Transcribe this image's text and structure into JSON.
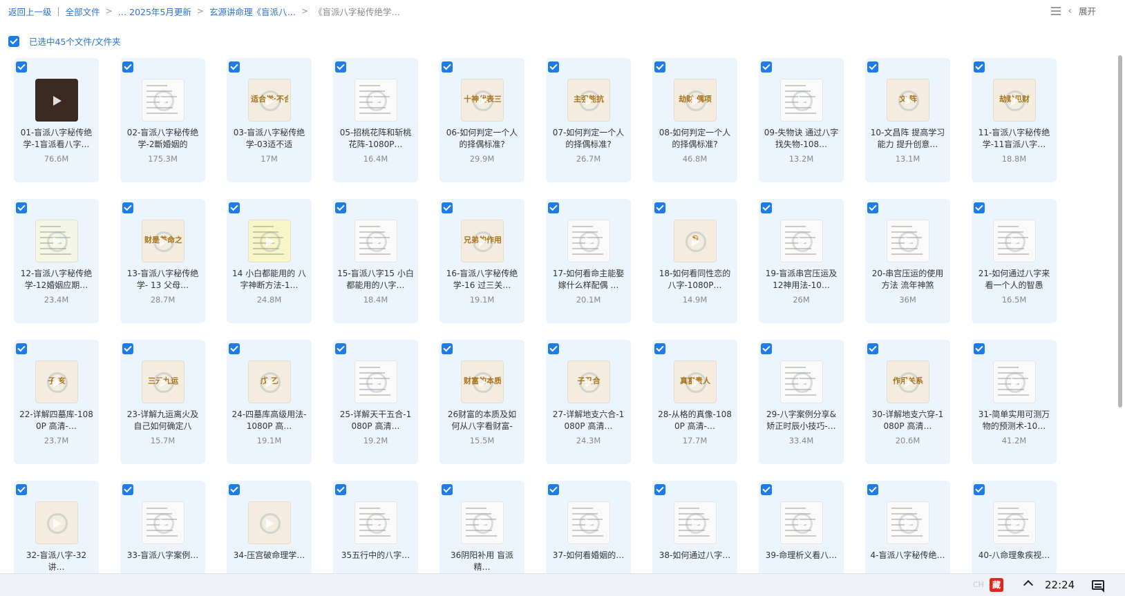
{
  "breadcrumb": {
    "items": [
      "返回上一级",
      "全部文件",
      "… 2025年5月更新",
      "玄源讲命理《盲派八…",
      "《盲派八字秘传绝学…"
    ],
    "separators": [
      "|",
      ">",
      ">",
      ">"
    ]
  },
  "toolbar": {
    "expand_label": "展开"
  },
  "selection": {
    "label": "已选中45个文件/文件夹"
  },
  "files": [
    {
      "name": "01-盲派八字秘传绝学-1盲派看八字…",
      "size": "76.6M",
      "thumb": "dark",
      "text": ""
    },
    {
      "name": "02-盲派八字秘传绝学-2斷婚姻的",
      "size": "175.3M",
      "thumb": "table",
      "text": ""
    },
    {
      "name": "03-盲派八字秘传绝学-03适不适",
      "size": "17M",
      "thumb": "paper",
      "text": "适合学·不合"
    },
    {
      "name": "05-招桃花阵和斩桃花阵-1080P…",
      "size": "16.4M",
      "thumb": "white",
      "text": ""
    },
    {
      "name": "06-如何判定一个人的择偶标准?",
      "size": "29.9M",
      "thumb": "paper",
      "text": "十神代表三观"
    },
    {
      "name": "07-如何判定一个人的择偶标准?",
      "size": "26.7M",
      "thumb": "paper",
      "text": "主强能抗"
    },
    {
      "name": "08-如何判定一个人的择偶标准?",
      "size": "46.8M",
      "thumb": "paper",
      "text": "劫财·偶项"
    },
    {
      "name": "09-失物诀 通过八字找失物-108…",
      "size": "13.2M",
      "thumb": "table",
      "text": ""
    },
    {
      "name": "10-文昌阵 提高学习能力 提升创意…",
      "size": "13.1M",
      "thumb": "paper",
      "text": "文 阵"
    },
    {
      "name": "11-盲派八字秘传绝学-11盲派八字…",
      "size": "18.8M",
      "thumb": "paper",
      "text": "劫财见财"
    },
    {
      "name": "12-盲派八字秘传绝学-12婚姻应期…",
      "size": "23.4M",
      "thumb": "green",
      "text": ""
    },
    {
      "name": "13-盲派八字秘传绝学- 13 父母…",
      "size": "28.7M",
      "thumb": "paper",
      "text": "财是养命之源"
    },
    {
      "name": "14 小白都能用的 八字神断方法-1…",
      "size": "24.8M",
      "thumb": "yellow",
      "text": ""
    },
    {
      "name": "15-盲派八字15 小白都能用的八字…",
      "size": "18.4M",
      "thumb": "table",
      "text": ""
    },
    {
      "name": "16-盲派八字秘传绝学-16 过三关…",
      "size": "19.1M",
      "thumb": "paper",
      "text": "兄弟的作用"
    },
    {
      "name": "17-如何看命主能娶嫁什么样配偶 …",
      "size": "20.1M",
      "thumb": "white",
      "text": ""
    },
    {
      "name": "18-如何看同性恋的八字-1080P…",
      "size": "14.9M",
      "thumb": "paper",
      "text": "☯"
    },
    {
      "name": "19-盲派串宫压运及12神用法-10…",
      "size": "26M",
      "thumb": "table",
      "text": ""
    },
    {
      "name": "20-串宫压运的使用方法 流年神煞",
      "size": "36M",
      "thumb": "table",
      "text": ""
    },
    {
      "name": "21-如何通过八字来看一个人的智愚",
      "size": "16.5M",
      "thumb": "table",
      "text": ""
    },
    {
      "name": "22-详解四墓库-1080P 高清-…",
      "size": "23.7M",
      "thumb": "paper",
      "text": "子 亥"
    },
    {
      "name": "23-详解九运离火及自己如何确定八",
      "size": "15.7M",
      "thumb": "paper",
      "text": "三元九运"
    },
    {
      "name": "24-四墓库高级用法-1080P 高…",
      "size": "19.1M",
      "thumb": "paper",
      "text": "戊 乙"
    },
    {
      "name": "25-详解天干五合-1080P 高清…",
      "size": "19.2M",
      "thumb": "white",
      "text": ""
    },
    {
      "name": "26财富的本质及如何从八字看财富-",
      "size": "15.5M",
      "thumb": "paper",
      "text": "财富的本质"
    },
    {
      "name": "27-详解地支六合-1080P 高清…",
      "size": "24.3M",
      "thumb": "paper",
      "text": "子丑合"
    },
    {
      "name": "28-从格的真像-1080P 高清-…",
      "size": "17.7M",
      "thumb": "paper",
      "text": "真富贵人"
    },
    {
      "name": "29-八字案例分享&矫正时辰小技巧-…",
      "size": "33.4M",
      "thumb": "table",
      "text": ""
    },
    {
      "name": "30-详解地支六穿-1080P 高清…",
      "size": "20.6M",
      "thumb": "paper",
      "text": "作用关系"
    },
    {
      "name": "31-简单实用可测万物的预测术-10…",
      "size": "41.2M",
      "thumb": "white",
      "text": ""
    },
    {
      "name": "32-盲派八字-32讲…",
      "size": "",
      "thumb": "paper",
      "text": ""
    },
    {
      "name": "33-盲派八字案例…",
      "size": "",
      "thumb": "table",
      "text": ""
    },
    {
      "name": "34-压宫破命理学…",
      "size": "",
      "thumb": "paper",
      "text": ""
    },
    {
      "name": "35五行中的八字…",
      "size": "",
      "thumb": "table",
      "text": ""
    },
    {
      "name": "36阴阳补用 盲派精…",
      "size": "",
      "thumb": "white",
      "text": ""
    },
    {
      "name": "37-如何看婚姻的…",
      "size": "",
      "thumb": "white",
      "text": ""
    },
    {
      "name": "38-如何通过八字…",
      "size": "",
      "thumb": "white",
      "text": ""
    },
    {
      "name": "39-命理析义看八…",
      "size": "",
      "thumb": "table",
      "text": ""
    },
    {
      "name": "4-盲派八字秘传绝…",
      "size": "",
      "thumb": "table",
      "text": ""
    },
    {
      "name": "40-八命理象疾视…",
      "size": "",
      "thumb": "white",
      "text": ""
    }
  ],
  "taskbar": {
    "tray_faint": "CH",
    "tray_red": "藏",
    "clock": "22:24"
  },
  "colors": {
    "accent": "#1e7ce8",
    "card_bg": "#ecf5fd",
    "link": "#2a73d9"
  }
}
